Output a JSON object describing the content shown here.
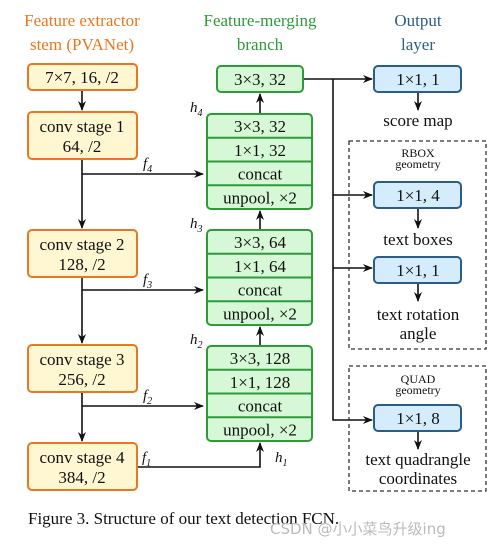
{
  "colors": {
    "stem": "#e87722",
    "stem_fill": "#fff6d2",
    "merge": "#2f9a3a",
    "merge_fill": "#d6f8d6",
    "output": "#2a5d8a",
    "output_fill": "#d4ecfb"
  },
  "headers": {
    "stem": [
      "Feature extractor",
      "stem (PVANet)"
    ],
    "merge": [
      "Feature-merging",
      "branch"
    ],
    "output": [
      "Output",
      "layer"
    ]
  },
  "stem": {
    "first": "7×7, 16, /2",
    "stages": [
      [
        "conv stage 1",
        "64, /2"
      ],
      [
        "conv stage 2",
        "128, /2"
      ],
      [
        "conv stage 3",
        "256, /2"
      ],
      [
        "conv stage 4",
        "384, /2"
      ]
    ]
  },
  "features": [
    {
      "f": "f",
      "sub": "4"
    },
    {
      "f": "f",
      "sub": "3"
    },
    {
      "f": "f",
      "sub": "2"
    },
    {
      "f": "f",
      "sub": "1"
    }
  ],
  "merge": {
    "top": "3×3, 32",
    "groups": [
      {
        "h": "h",
        "sub": "4",
        "rows": [
          "3×3, 32",
          "1×1, 32",
          "concat",
          "unpool, ×2"
        ]
      },
      {
        "h": "h",
        "sub": "3",
        "rows": [
          "3×3, 64",
          "1×1, 64",
          "concat",
          "unpool, ×2"
        ]
      },
      {
        "h": "h",
        "sub": "2",
        "rows": [
          "3×3, 128",
          "1×1, 128",
          "concat",
          "unpool, ×2"
        ]
      }
    ],
    "h1": {
      "h": "h",
      "sub": "1"
    }
  },
  "output": {
    "score": {
      "box": "1×1, 1",
      "label": "score map"
    },
    "rbox": {
      "title": [
        "RBOX",
        "geometry"
      ],
      "boxes": {
        "box": "1×1, 4",
        "label": "text boxes"
      },
      "angle": {
        "box": "1×1, 1",
        "label": [
          "text rotation",
          "angle"
        ]
      }
    },
    "quad": {
      "title": [
        "QUAD",
        "geometry"
      ],
      "box": "1×1, 8",
      "label": [
        "text quadrangle",
        "coordinates"
      ]
    }
  },
  "caption": "Figure 3. Structure of our text detection FCN.",
  "watermark": "CSDN @小小菜鸟升级ing"
}
